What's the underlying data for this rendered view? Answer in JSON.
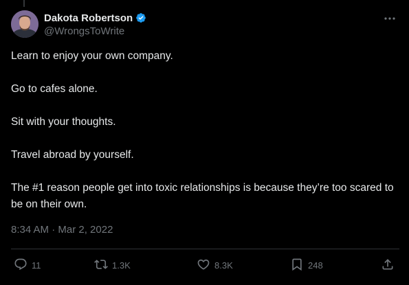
{
  "author": {
    "display_name": "Dakota Robertson",
    "handle": "@WrongsToWrite",
    "verified": true
  },
  "tweet": {
    "paragraphs": [
      "Learn to enjoy your own company.",
      "Go to cafes alone.",
      "Sit with your thoughts.",
      "Travel abroad by yourself.",
      "The #1 reason people get into toxic relationships is because they’re too scared to be on their own."
    ],
    "timestamp": "8:34 AM · Mar 2, 2022"
  },
  "actions": {
    "replies": "11",
    "retweets": "1.3K",
    "likes": "8.3K",
    "bookmarks": "248"
  },
  "icons": {
    "verified": "verified-badge-icon",
    "more": "more-horizontal-icon",
    "reply": "reply-icon",
    "retweet": "retweet-icon",
    "like": "heart-icon",
    "bookmark": "bookmark-icon",
    "share": "share-icon"
  },
  "colors": {
    "background": "#000000",
    "text": "#e7e9ea",
    "secondary": "#71767b",
    "verified": "#1d9bf0",
    "divider": "#2f3336"
  }
}
